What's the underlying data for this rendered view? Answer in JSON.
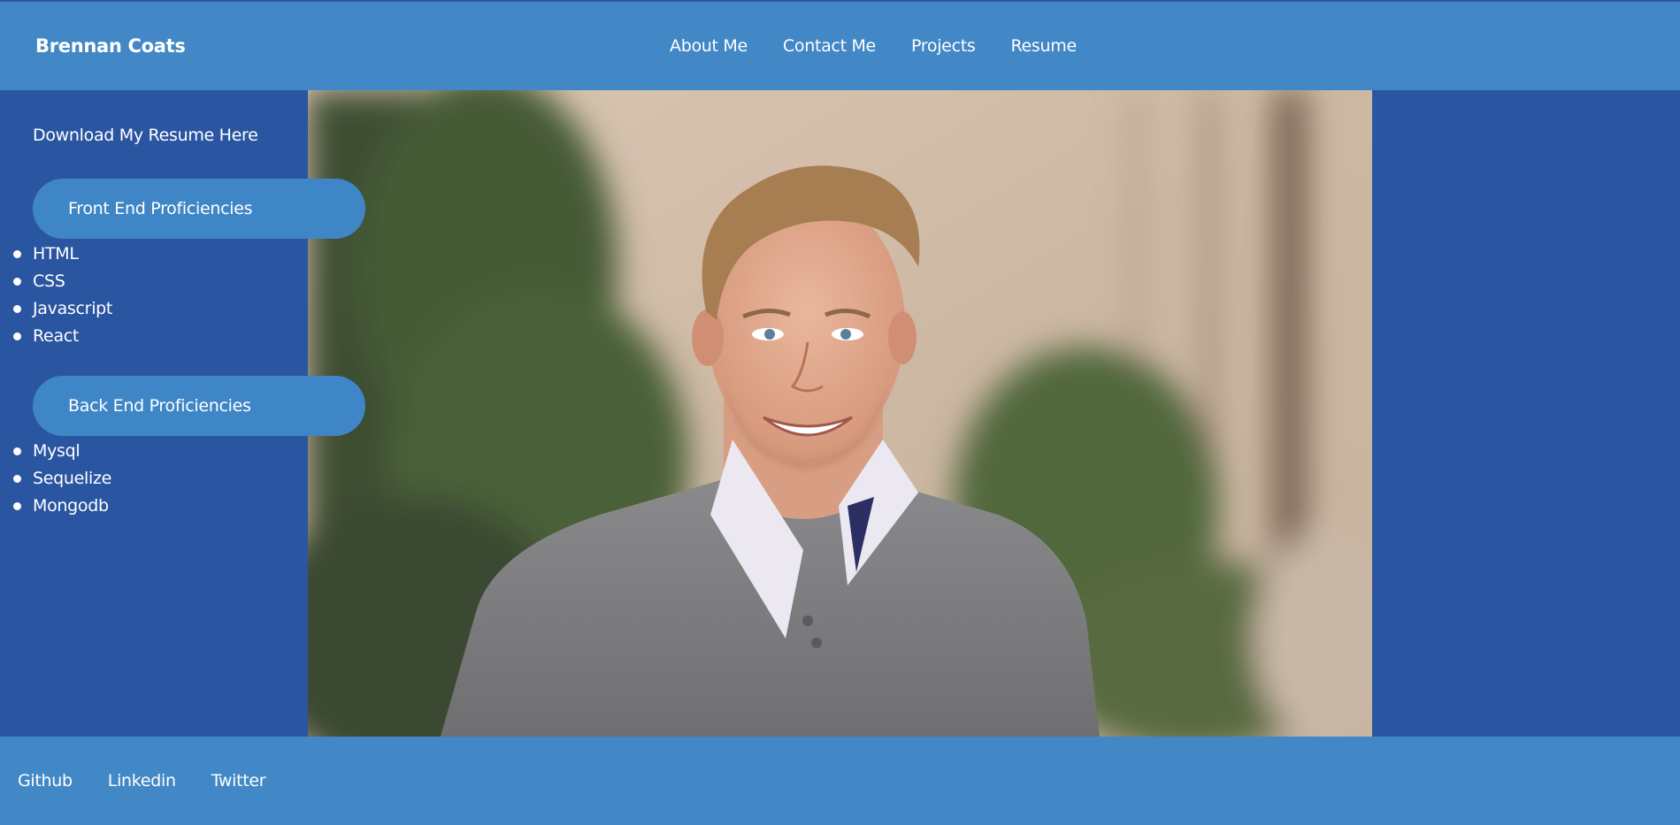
{
  "header": {
    "brand": "Brennan Coats",
    "nav": [
      {
        "label": "About Me"
      },
      {
        "label": "Contact Me"
      },
      {
        "label": "Projects"
      },
      {
        "label": "Resume"
      }
    ]
  },
  "sidebar": {
    "download_label": "Download My Resume Here",
    "front_end": {
      "title": "Front End Proficiencies",
      "items": [
        "HTML",
        "CSS",
        "Javascript",
        "React"
      ]
    },
    "back_end": {
      "title": "Back End Proficiencies",
      "items": [
        "Mysql",
        "Sequelize",
        "Mongodb"
      ]
    }
  },
  "photo": {
    "alt": "Portrait photo"
  },
  "footer": {
    "links": [
      {
        "label": "Github"
      },
      {
        "label": "Linkedin"
      },
      {
        "label": "Twitter"
      }
    ]
  },
  "colors": {
    "header_bg": "#4287c6",
    "page_bg": "#2a55a0",
    "pill_bg": "#3f86c7",
    "text": "#ffffff"
  }
}
